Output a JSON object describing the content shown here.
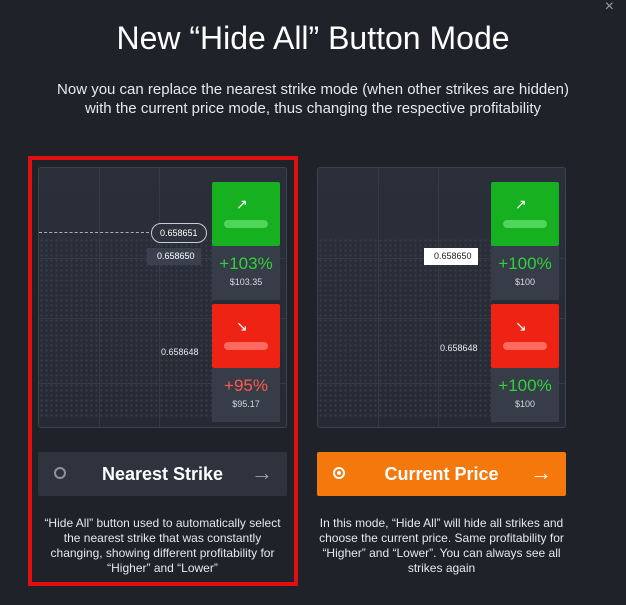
{
  "close_glyph": "×",
  "title": "New “Hide All” Button Mode",
  "subtitle": "Now you can replace the nearest strike mode (when other strikes are hidden) with the current price mode, thus changing the respective profitability",
  "left": {
    "bubble_price": "0.658651",
    "flag_price": "0.658650",
    "low_price": "0.658648",
    "higher": {
      "glyph": "↗",
      "percent": "+103%",
      "amount": "$103.35"
    },
    "lower": {
      "glyph": "↘",
      "percent": "+95%",
      "amount": "$95.17"
    },
    "mode_label": "Nearest Strike",
    "arrow": "→",
    "description": "“Hide All” button used to automatically select the nearest strike that was constantly changing, showing different profitability for “Higher” and “Lower”",
    "selected": false
  },
  "right": {
    "flag_price": "0.658650",
    "low_price": "0.658648",
    "higher": {
      "glyph": "↗",
      "percent": "+100%",
      "amount": "$100"
    },
    "lower": {
      "glyph": "↘",
      "percent": "+100%",
      "amount": "$100"
    },
    "mode_label": "Current Price",
    "arrow": "→",
    "description": "In this mode, “Hide All” will hide all strikes and choose the current price. Same profitability for “Higher” and “Lower”. You can always see all strikes again",
    "selected": true
  },
  "colors": {
    "background": "#1f2229",
    "highlight_border": "#e10f0f",
    "higher_green": "#17b020",
    "lower_red": "#ef2313",
    "accent_orange": "#f4780c"
  }
}
